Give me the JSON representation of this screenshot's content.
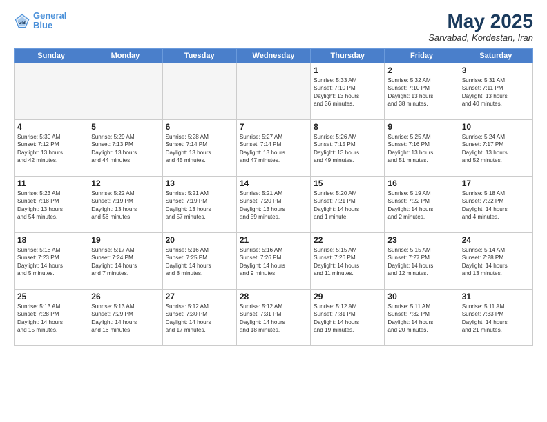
{
  "header": {
    "logo_line1": "General",
    "logo_line2": "Blue",
    "month": "May 2025",
    "location": "Sarvabad, Kordestan, Iran"
  },
  "weekdays": [
    "Sunday",
    "Monday",
    "Tuesday",
    "Wednesday",
    "Thursday",
    "Friday",
    "Saturday"
  ],
  "weeks": [
    [
      {
        "day": "",
        "info": ""
      },
      {
        "day": "",
        "info": ""
      },
      {
        "day": "",
        "info": ""
      },
      {
        "day": "",
        "info": ""
      },
      {
        "day": "1",
        "info": "Sunrise: 5:33 AM\nSunset: 7:10 PM\nDaylight: 13 hours\nand 36 minutes."
      },
      {
        "day": "2",
        "info": "Sunrise: 5:32 AM\nSunset: 7:10 PM\nDaylight: 13 hours\nand 38 minutes."
      },
      {
        "day": "3",
        "info": "Sunrise: 5:31 AM\nSunset: 7:11 PM\nDaylight: 13 hours\nand 40 minutes."
      }
    ],
    [
      {
        "day": "4",
        "info": "Sunrise: 5:30 AM\nSunset: 7:12 PM\nDaylight: 13 hours\nand 42 minutes."
      },
      {
        "day": "5",
        "info": "Sunrise: 5:29 AM\nSunset: 7:13 PM\nDaylight: 13 hours\nand 44 minutes."
      },
      {
        "day": "6",
        "info": "Sunrise: 5:28 AM\nSunset: 7:14 PM\nDaylight: 13 hours\nand 45 minutes."
      },
      {
        "day": "7",
        "info": "Sunrise: 5:27 AM\nSunset: 7:14 PM\nDaylight: 13 hours\nand 47 minutes."
      },
      {
        "day": "8",
        "info": "Sunrise: 5:26 AM\nSunset: 7:15 PM\nDaylight: 13 hours\nand 49 minutes."
      },
      {
        "day": "9",
        "info": "Sunrise: 5:25 AM\nSunset: 7:16 PM\nDaylight: 13 hours\nand 51 minutes."
      },
      {
        "day": "10",
        "info": "Sunrise: 5:24 AM\nSunset: 7:17 PM\nDaylight: 13 hours\nand 52 minutes."
      }
    ],
    [
      {
        "day": "11",
        "info": "Sunrise: 5:23 AM\nSunset: 7:18 PM\nDaylight: 13 hours\nand 54 minutes."
      },
      {
        "day": "12",
        "info": "Sunrise: 5:22 AM\nSunset: 7:19 PM\nDaylight: 13 hours\nand 56 minutes."
      },
      {
        "day": "13",
        "info": "Sunrise: 5:21 AM\nSunset: 7:19 PM\nDaylight: 13 hours\nand 57 minutes."
      },
      {
        "day": "14",
        "info": "Sunrise: 5:21 AM\nSunset: 7:20 PM\nDaylight: 13 hours\nand 59 minutes."
      },
      {
        "day": "15",
        "info": "Sunrise: 5:20 AM\nSunset: 7:21 PM\nDaylight: 14 hours\nand 1 minute."
      },
      {
        "day": "16",
        "info": "Sunrise: 5:19 AM\nSunset: 7:22 PM\nDaylight: 14 hours\nand 2 minutes."
      },
      {
        "day": "17",
        "info": "Sunrise: 5:18 AM\nSunset: 7:22 PM\nDaylight: 14 hours\nand 4 minutes."
      }
    ],
    [
      {
        "day": "18",
        "info": "Sunrise: 5:18 AM\nSunset: 7:23 PM\nDaylight: 14 hours\nand 5 minutes."
      },
      {
        "day": "19",
        "info": "Sunrise: 5:17 AM\nSunset: 7:24 PM\nDaylight: 14 hours\nand 7 minutes."
      },
      {
        "day": "20",
        "info": "Sunrise: 5:16 AM\nSunset: 7:25 PM\nDaylight: 14 hours\nand 8 minutes."
      },
      {
        "day": "21",
        "info": "Sunrise: 5:16 AM\nSunset: 7:26 PM\nDaylight: 14 hours\nand 9 minutes."
      },
      {
        "day": "22",
        "info": "Sunrise: 5:15 AM\nSunset: 7:26 PM\nDaylight: 14 hours\nand 11 minutes."
      },
      {
        "day": "23",
        "info": "Sunrise: 5:15 AM\nSunset: 7:27 PM\nDaylight: 14 hours\nand 12 minutes."
      },
      {
        "day": "24",
        "info": "Sunrise: 5:14 AM\nSunset: 7:28 PM\nDaylight: 14 hours\nand 13 minutes."
      }
    ],
    [
      {
        "day": "25",
        "info": "Sunrise: 5:13 AM\nSunset: 7:28 PM\nDaylight: 14 hours\nand 15 minutes."
      },
      {
        "day": "26",
        "info": "Sunrise: 5:13 AM\nSunset: 7:29 PM\nDaylight: 14 hours\nand 16 minutes."
      },
      {
        "day": "27",
        "info": "Sunrise: 5:12 AM\nSunset: 7:30 PM\nDaylight: 14 hours\nand 17 minutes."
      },
      {
        "day": "28",
        "info": "Sunrise: 5:12 AM\nSunset: 7:31 PM\nDaylight: 14 hours\nand 18 minutes."
      },
      {
        "day": "29",
        "info": "Sunrise: 5:12 AM\nSunset: 7:31 PM\nDaylight: 14 hours\nand 19 minutes."
      },
      {
        "day": "30",
        "info": "Sunrise: 5:11 AM\nSunset: 7:32 PM\nDaylight: 14 hours\nand 20 minutes."
      },
      {
        "day": "31",
        "info": "Sunrise: 5:11 AM\nSunset: 7:33 PM\nDaylight: 14 hours\nand 21 minutes."
      }
    ]
  ]
}
